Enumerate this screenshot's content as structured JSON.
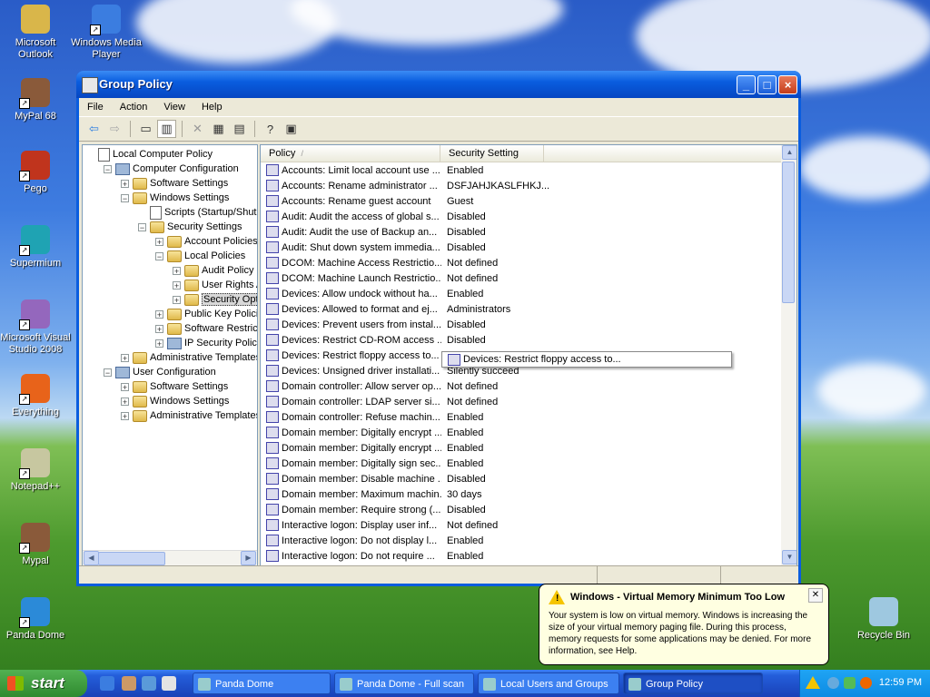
{
  "window": {
    "title": "Group Policy",
    "menu": [
      "File",
      "Action",
      "View",
      "Help"
    ]
  },
  "desktop_icons": [
    "Microsoft Outlook",
    "Windows Media Player",
    "MyPal 68",
    "Pego",
    "Supermium",
    "Microsoft Visual Studio 2008",
    "Everything",
    "Notepad++",
    "Mypal",
    "Panda Dome",
    "Recycle Bin"
  ],
  "tree": [
    {
      "label": "Local Computer Policy",
      "level": 0,
      "expand": "",
      "icon": "doc"
    },
    {
      "label": "Computer Configuration",
      "level": 1,
      "expand": "-",
      "icon": "pc"
    },
    {
      "label": "Software Settings",
      "level": 2,
      "expand": "+",
      "icon": "folder"
    },
    {
      "label": "Windows Settings",
      "level": 2,
      "expand": "-",
      "icon": "folder"
    },
    {
      "label": "Scripts (Startup/Shutdown)",
      "level": 3,
      "expand": "",
      "icon": "doc"
    },
    {
      "label": "Security Settings",
      "level": 3,
      "expand": "-",
      "icon": "folder"
    },
    {
      "label": "Account Policies",
      "level": 4,
      "expand": "+",
      "icon": "folder"
    },
    {
      "label": "Local Policies",
      "level": 4,
      "expand": "-",
      "icon": "folder"
    },
    {
      "label": "Audit Policy",
      "level": 5,
      "expand": "+",
      "icon": "folder"
    },
    {
      "label": "User Rights Assignment",
      "level": 5,
      "expand": "+",
      "icon": "folder"
    },
    {
      "label": "Security Options",
      "level": 5,
      "expand": "+",
      "icon": "folder",
      "selected": true
    },
    {
      "label": "Public Key Policies",
      "level": 4,
      "expand": "+",
      "icon": "folder"
    },
    {
      "label": "Software Restriction Policies",
      "level": 4,
      "expand": "+",
      "icon": "folder"
    },
    {
      "label": "IP Security Policies",
      "level": 4,
      "expand": "+",
      "icon": "pc"
    },
    {
      "label": "Administrative Templates",
      "level": 2,
      "expand": "+",
      "icon": "folder"
    },
    {
      "label": "User Configuration",
      "level": 1,
      "expand": "-",
      "icon": "pc"
    },
    {
      "label": "Software Settings",
      "level": 2,
      "expand": "+",
      "icon": "folder"
    },
    {
      "label": "Windows Settings",
      "level": 2,
      "expand": "+",
      "icon": "folder"
    },
    {
      "label": "Administrative Templates",
      "level": 2,
      "expand": "+",
      "icon": "folder"
    }
  ],
  "list": {
    "headers": {
      "policy": "Policy",
      "setting": "Security Setting"
    },
    "rows": [
      {
        "policy": "Accounts: Limit local account use ...",
        "setting": "Enabled"
      },
      {
        "policy": "Accounts: Rename administrator ...",
        "setting": "DSFJAHJKASLFHKJ..."
      },
      {
        "policy": "Accounts: Rename guest account",
        "setting": "Guest"
      },
      {
        "policy": "Audit: Audit the access of global s...",
        "setting": "Disabled"
      },
      {
        "policy": "Audit: Audit the use of Backup an...",
        "setting": "Disabled"
      },
      {
        "policy": "Audit: Shut down system immedia...",
        "setting": "Disabled"
      },
      {
        "policy": "DCOM: Machine Access Restrictio...",
        "setting": "Not defined"
      },
      {
        "policy": "DCOM: Machine Launch Restrictio...",
        "setting": "Not defined"
      },
      {
        "policy": "Devices: Allow undock without ha...",
        "setting": "Enabled"
      },
      {
        "policy": "Devices: Allowed to format and ej...",
        "setting": "Administrators"
      },
      {
        "policy": "Devices: Prevent users from instal...",
        "setting": "Disabled"
      },
      {
        "policy": "Devices: Restrict CD-ROM access ...",
        "setting": "Disabled"
      },
      {
        "policy": "Devices: Restrict floppy access to...",
        "setting": "Disabled"
      },
      {
        "policy": "Devices: Unsigned driver installati...",
        "setting": "Silently succeed"
      },
      {
        "policy": "Domain controller: Allow server op...",
        "setting": "Not defined"
      },
      {
        "policy": "Domain controller: LDAP server si...",
        "setting": "Not defined"
      },
      {
        "policy": "Domain controller: Refuse machin...",
        "setting": "Enabled"
      },
      {
        "policy": "Domain member: Digitally encrypt ...",
        "setting": "Enabled"
      },
      {
        "policy": "Domain member: Digitally encrypt ...",
        "setting": "Enabled"
      },
      {
        "policy": "Domain member: Digitally sign sec...",
        "setting": "Enabled"
      },
      {
        "policy": "Domain member: Disable machine ...",
        "setting": "Disabled"
      },
      {
        "policy": "Domain member: Maximum machin...",
        "setting": "30 days"
      },
      {
        "policy": "Domain member: Require strong (...",
        "setting": "Disabled"
      },
      {
        "policy": "Interactive logon: Display user inf...",
        "setting": "Not defined"
      },
      {
        "policy": "Interactive logon: Do not display l...",
        "setting": "Enabled"
      },
      {
        "policy": "Interactive logon: Do not require ...",
        "setting": "Enabled"
      }
    ],
    "tooltip": "Devices: Restrict floppy access to..."
  },
  "balloon": {
    "title": "Windows - Virtual Memory Minimum Too Low",
    "body": "Your system is low on virtual memory. Windows is increasing the size of your virtual memory paging file. During this process, memory requests for some applications may be denied. For more information, see Help."
  },
  "taskbar": {
    "start": "start",
    "tasks": [
      {
        "label": "Panda Dome",
        "active": false
      },
      {
        "label": "Panda Dome - Full scan",
        "active": false
      },
      {
        "label": "Local Users and Groups",
        "active": false
      },
      {
        "label": "Group Policy",
        "active": true
      }
    ],
    "clock": "12:59 PM"
  }
}
